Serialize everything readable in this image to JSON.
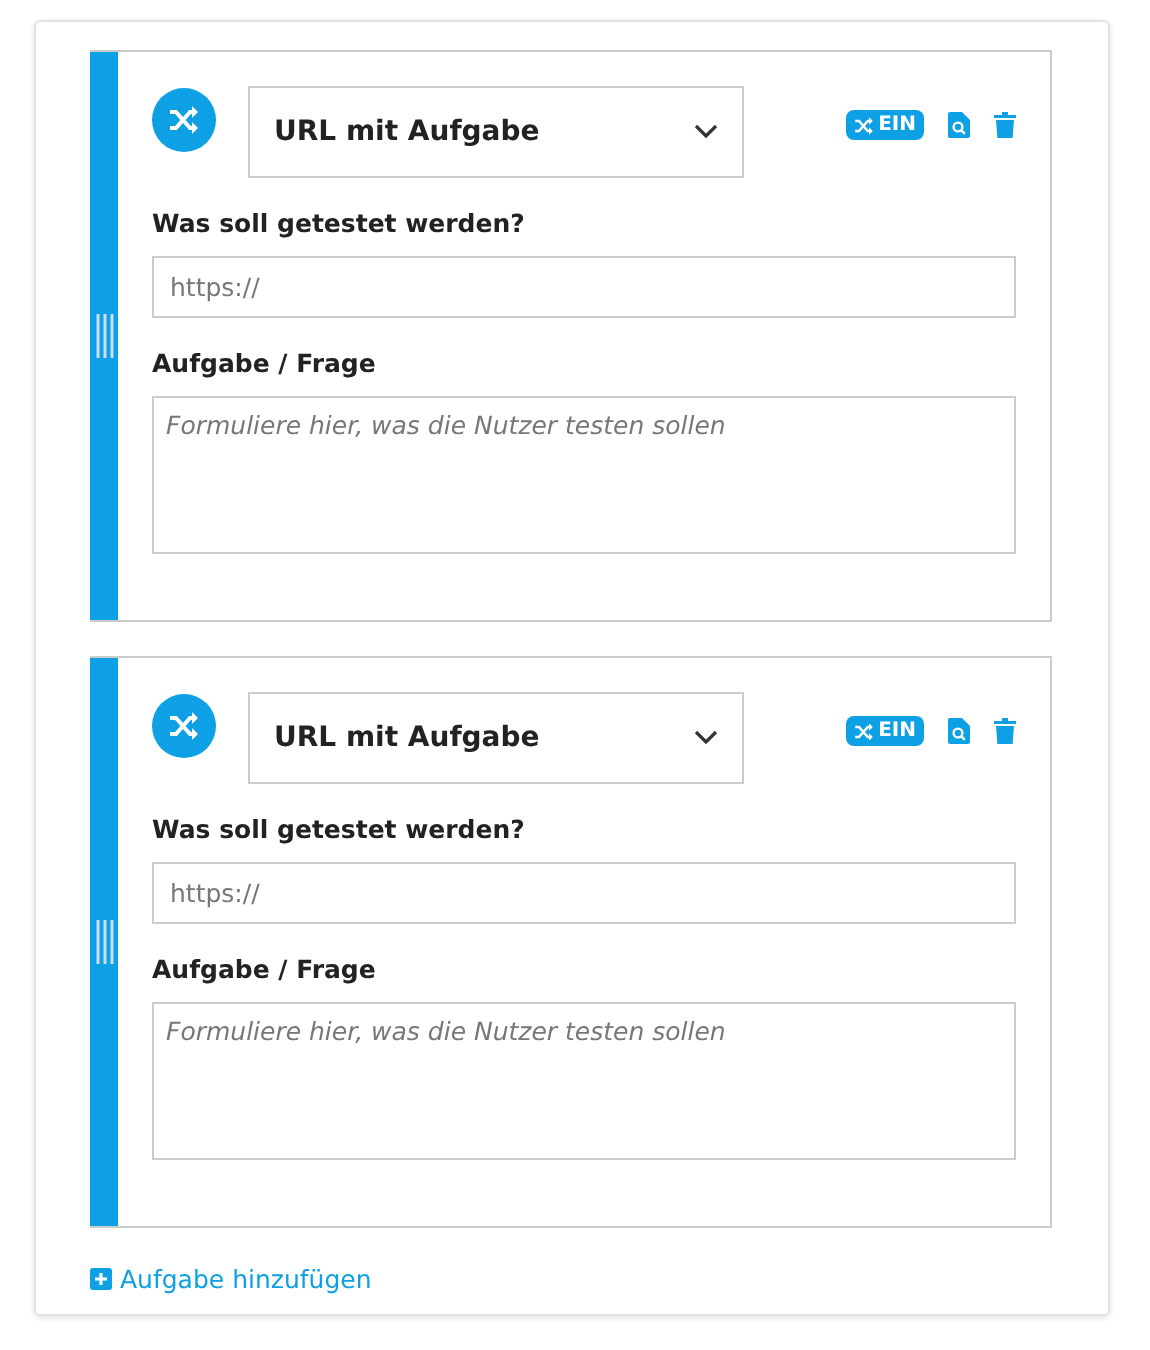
{
  "tasks": [
    {
      "type": "URL mit Aufgabe",
      "shuffle": {
        "label": "EIN",
        "on": true
      },
      "url_label": "Was soll getestet werden?",
      "url_placeholder": "https://",
      "task_label": "Aufgabe / Frage",
      "task_placeholder": "Formuliere hier, was die Nutzer testen sollen"
    },
    {
      "type": "URL mit Aufgabe",
      "shuffle": {
        "label": "EIN",
        "on": true
      },
      "url_label": "Was soll getestet werden?",
      "url_placeholder": "https://",
      "task_label": "Aufgabe / Frage",
      "task_placeholder": "Formuliere hier, was die Nutzer testen sollen"
    }
  ],
  "add_link": "Aufgabe hinzufügen"
}
